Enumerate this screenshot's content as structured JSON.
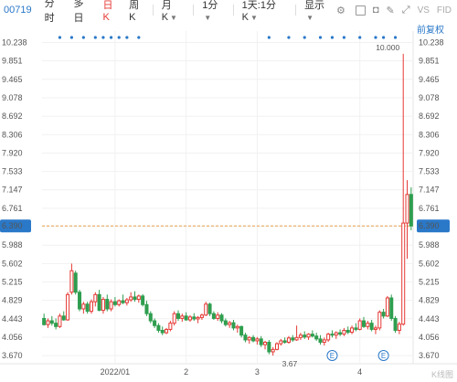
{
  "toolbar": {
    "code": "00719",
    "tabs": [
      "分时",
      "多日",
      "日K",
      "周K"
    ],
    "active_tab": "日K",
    "month_k": "月K",
    "period": "1分",
    "multi": "1天:1分K",
    "display": "显示",
    "vs": "VS",
    "fid": "FID",
    "icons": [
      "checkbox-icon",
      "camera-icon",
      "draw-icon",
      "fullscreen-icon",
      "settings-icon"
    ]
  },
  "adjust_label": "前复权",
  "watermark": "K线图",
  "colors": {
    "up": "#e53935",
    "down": "#2e9e4f",
    "current_line": "#e6a04a",
    "price_badge": "#2a78c8",
    "dots": "#2a78c8"
  },
  "chart_data": {
    "type": "candlestick",
    "y_ticks": [
      "10.238",
      "9.851",
      "9.465",
      "9.078",
      "8.692",
      "8.306",
      "7.920",
      "7.533",
      "7.147",
      "6.761",
      "6.390",
      "5.988",
      "5.602",
      "5.215",
      "4.829",
      "4.443",
      "4.056",
      "3.670"
    ],
    "y_tick_values": [
      10.238,
      9.851,
      9.465,
      9.078,
      8.692,
      8.306,
      7.92,
      7.533,
      7.147,
      6.761,
      6.39,
      5.988,
      5.602,
      5.215,
      4.829,
      4.443,
      4.056,
      3.67
    ],
    "ylim": [
      3.5,
      10.4
    ],
    "x_ticks": [
      {
        "label": "2022/01",
        "index": 18
      },
      {
        "label": "2",
        "index": 36
      },
      {
        "label": "3",
        "index": 54
      },
      {
        "label": "4",
        "index": 80
      }
    ],
    "current_price": 6.39,
    "current_price_label": "6.390",
    "max_label": "10.000",
    "min_label": "3.67",
    "event_markers": [
      {
        "index": 73,
        "label": "E"
      },
      {
        "index": 86,
        "label": "E"
      }
    ],
    "dot_indices": [
      4,
      7,
      10,
      13,
      15,
      17,
      19,
      21,
      24,
      57,
      62,
      66,
      70,
      73,
      76,
      80,
      84,
      86,
      89
    ],
    "candles": [
      {
        "o": 4.45,
        "h": 4.55,
        "l": 4.3,
        "c": 4.32
      },
      {
        "o": 4.32,
        "h": 4.45,
        "l": 4.25,
        "c": 4.4
      },
      {
        "o": 4.4,
        "h": 4.5,
        "l": 4.3,
        "c": 4.35
      },
      {
        "o": 4.35,
        "h": 4.45,
        "l": 4.22,
        "c": 4.28
      },
      {
        "o": 4.28,
        "h": 4.55,
        "l": 4.25,
        "c": 4.5
      },
      {
        "o": 4.5,
        "h": 4.6,
        "l": 4.4,
        "c": 4.42
      },
      {
        "o": 4.42,
        "h": 5.0,
        "l": 4.4,
        "c": 4.95
      },
      {
        "o": 5.0,
        "h": 5.6,
        "l": 4.95,
        "c": 5.45
      },
      {
        "o": 5.4,
        "h": 5.45,
        "l": 4.95,
        "c": 5.0
      },
      {
        "o": 5.0,
        "h": 5.05,
        "l": 4.6,
        "c": 4.65
      },
      {
        "o": 4.65,
        "h": 4.8,
        "l": 4.55,
        "c": 4.75
      },
      {
        "o": 4.75,
        "h": 4.8,
        "l": 4.55,
        "c": 4.6
      },
      {
        "o": 4.6,
        "h": 4.85,
        "l": 4.55,
        "c": 4.8
      },
      {
        "o": 4.8,
        "h": 5.0,
        "l": 4.7,
        "c": 4.95
      },
      {
        "o": 4.95,
        "h": 5.05,
        "l": 4.6,
        "c": 4.62
      },
      {
        "o": 4.62,
        "h": 4.9,
        "l": 4.55,
        "c": 4.85
      },
      {
        "o": 4.85,
        "h": 4.95,
        "l": 4.6,
        "c": 4.65
      },
      {
        "o": 4.65,
        "h": 4.85,
        "l": 4.6,
        "c": 4.8
      },
      {
        "o": 4.8,
        "h": 4.9,
        "l": 4.7,
        "c": 4.74
      },
      {
        "o": 4.74,
        "h": 4.85,
        "l": 4.7,
        "c": 4.82
      },
      {
        "o": 4.82,
        "h": 4.95,
        "l": 4.75,
        "c": 4.78
      },
      {
        "o": 4.78,
        "h": 4.88,
        "l": 4.72,
        "c": 4.84
      },
      {
        "o": 4.84,
        "h": 5.0,
        "l": 4.8,
        "c": 4.9
      },
      {
        "o": 4.9,
        "h": 5.02,
        "l": 4.8,
        "c": 4.85
      },
      {
        "o": 4.85,
        "h": 4.95,
        "l": 4.78,
        "c": 4.92
      },
      {
        "o": 4.92,
        "h": 4.96,
        "l": 4.7,
        "c": 4.74
      },
      {
        "o": 4.74,
        "h": 4.82,
        "l": 4.5,
        "c": 4.55
      },
      {
        "o": 4.55,
        "h": 4.6,
        "l": 4.35,
        "c": 4.4
      },
      {
        "o": 4.4,
        "h": 4.45,
        "l": 4.25,
        "c": 4.3
      },
      {
        "o": 4.3,
        "h": 4.35,
        "l": 4.15,
        "c": 4.2
      },
      {
        "o": 4.2,
        "h": 4.28,
        "l": 4.1,
        "c": 4.15
      },
      {
        "o": 4.15,
        "h": 4.25,
        "l": 4.12,
        "c": 4.22
      },
      {
        "o": 4.22,
        "h": 4.4,
        "l": 4.18,
        "c": 4.35
      },
      {
        "o": 4.35,
        "h": 4.6,
        "l": 4.3,
        "c": 4.55
      },
      {
        "o": 4.55,
        "h": 4.62,
        "l": 4.4,
        "c": 4.45
      },
      {
        "o": 4.45,
        "h": 4.55,
        "l": 4.38,
        "c": 4.5
      },
      {
        "o": 4.5,
        "h": 4.58,
        "l": 4.4,
        "c": 4.42
      },
      {
        "o": 4.42,
        "h": 4.52,
        "l": 4.38,
        "c": 4.48
      },
      {
        "o": 4.48,
        "h": 4.56,
        "l": 4.4,
        "c": 4.44
      },
      {
        "o": 4.44,
        "h": 4.5,
        "l": 4.35,
        "c": 4.47
      },
      {
        "o": 4.47,
        "h": 4.55,
        "l": 4.42,
        "c": 4.52
      },
      {
        "o": 4.52,
        "h": 4.8,
        "l": 4.5,
        "c": 4.75
      },
      {
        "o": 4.75,
        "h": 4.78,
        "l": 4.5,
        "c": 4.55
      },
      {
        "o": 4.55,
        "h": 4.6,
        "l": 4.42,
        "c": 4.45
      },
      {
        "o": 4.45,
        "h": 4.58,
        "l": 4.4,
        "c": 4.52
      },
      {
        "o": 4.52,
        "h": 4.56,
        "l": 4.35,
        "c": 4.4
      },
      {
        "o": 4.4,
        "h": 4.45,
        "l": 4.28,
        "c": 4.32
      },
      {
        "o": 4.32,
        "h": 4.4,
        "l": 4.25,
        "c": 4.36
      },
      {
        "o": 4.36,
        "h": 4.42,
        "l": 4.2,
        "c": 4.25
      },
      {
        "o": 4.25,
        "h": 4.32,
        "l": 4.15,
        "c": 4.28
      },
      {
        "o": 4.28,
        "h": 4.3,
        "l": 4.05,
        "c": 4.1
      },
      {
        "o": 4.1,
        "h": 4.15,
        "l": 3.95,
        "c": 4.0
      },
      {
        "o": 4.0,
        "h": 4.08,
        "l": 3.92,
        "c": 4.05
      },
      {
        "o": 4.05,
        "h": 4.1,
        "l": 3.95,
        "c": 3.98
      },
      {
        "o": 3.98,
        "h": 4.06,
        "l": 3.9,
        "c": 4.02
      },
      {
        "o": 4.02,
        "h": 4.08,
        "l": 3.85,
        "c": 3.9
      },
      {
        "o": 3.9,
        "h": 3.98,
        "l": 3.8,
        "c": 3.95
      },
      {
        "o": 3.95,
        "h": 4.0,
        "l": 3.7,
        "c": 3.75
      },
      {
        "o": 3.75,
        "h": 3.85,
        "l": 3.67,
        "c": 3.8
      },
      {
        "o": 3.8,
        "h": 3.95,
        "l": 3.78,
        "c": 3.92
      },
      {
        "o": 3.92,
        "h": 4.02,
        "l": 3.88,
        "c": 3.98
      },
      {
        "o": 3.98,
        "h": 4.05,
        "l": 3.92,
        "c": 3.95
      },
      {
        "o": 3.95,
        "h": 4.08,
        "l": 3.92,
        "c": 4.04
      },
      {
        "o": 4.04,
        "h": 4.1,
        "l": 3.96,
        "c": 4.0
      },
      {
        "o": 4.0,
        "h": 4.3,
        "l": 3.98,
        "c": 4.05
      },
      {
        "o": 4.05,
        "h": 4.15,
        "l": 4.0,
        "c": 4.1
      },
      {
        "o": 4.1,
        "h": 4.18,
        "l": 4.02,
        "c": 4.06
      },
      {
        "o": 4.06,
        "h": 4.14,
        "l": 4.0,
        "c": 4.12
      },
      {
        "o": 4.12,
        "h": 4.2,
        "l": 4.05,
        "c": 4.08
      },
      {
        "o": 4.08,
        "h": 4.15,
        "l": 3.98,
        "c": 4.02
      },
      {
        "o": 4.02,
        "h": 4.1,
        "l": 3.9,
        "c": 3.95
      },
      {
        "o": 3.95,
        "h": 4.05,
        "l": 3.88,
        "c": 4.0
      },
      {
        "o": 4.0,
        "h": 4.15,
        "l": 3.96,
        "c": 4.12
      },
      {
        "o": 4.12,
        "h": 4.2,
        "l": 4.05,
        "c": 4.1
      },
      {
        "o": 4.1,
        "h": 4.18,
        "l": 4.02,
        "c": 4.15
      },
      {
        "o": 4.15,
        "h": 4.22,
        "l": 4.08,
        "c": 4.12
      },
      {
        "o": 4.12,
        "h": 4.25,
        "l": 4.08,
        "c": 4.2
      },
      {
        "o": 4.2,
        "h": 4.28,
        "l": 4.12,
        "c": 4.16
      },
      {
        "o": 4.16,
        "h": 4.3,
        "l": 4.12,
        "c": 4.25
      },
      {
        "o": 4.25,
        "h": 4.35,
        "l": 4.18,
        "c": 4.22
      },
      {
        "o": 4.22,
        "h": 4.45,
        "l": 4.2,
        "c": 4.4
      },
      {
        "o": 4.4,
        "h": 4.48,
        "l": 4.25,
        "c": 4.28
      },
      {
        "o": 4.28,
        "h": 4.4,
        "l": 4.22,
        "c": 4.35
      },
      {
        "o": 4.35,
        "h": 4.42,
        "l": 4.18,
        "c": 4.22
      },
      {
        "o": 4.22,
        "h": 4.3,
        "l": 4.12,
        "c": 4.25
      },
      {
        "o": 4.25,
        "h": 4.62,
        "l": 4.2,
        "c": 4.58
      },
      {
        "o": 4.58,
        "h": 4.65,
        "l": 4.45,
        "c": 4.5
      },
      {
        "o": 4.5,
        "h": 4.92,
        "l": 4.48,
        "c": 4.88
      },
      {
        "o": 4.88,
        "h": 4.95,
        "l": 4.4,
        "c": 4.45
      },
      {
        "o": 4.45,
        "h": 4.5,
        "l": 4.15,
        "c": 4.2
      },
      {
        "o": 4.2,
        "h": 4.38,
        "l": 4.12,
        "c": 4.33
      },
      {
        "o": 4.33,
        "h": 10.0,
        "l": 4.3,
        "c": 6.45
      },
      {
        "o": 6.45,
        "h": 7.35,
        "l": 5.7,
        "c": 7.05
      },
      {
        "o": 7.05,
        "h": 7.2,
        "l": 6.3,
        "c": 6.39
      }
    ]
  }
}
